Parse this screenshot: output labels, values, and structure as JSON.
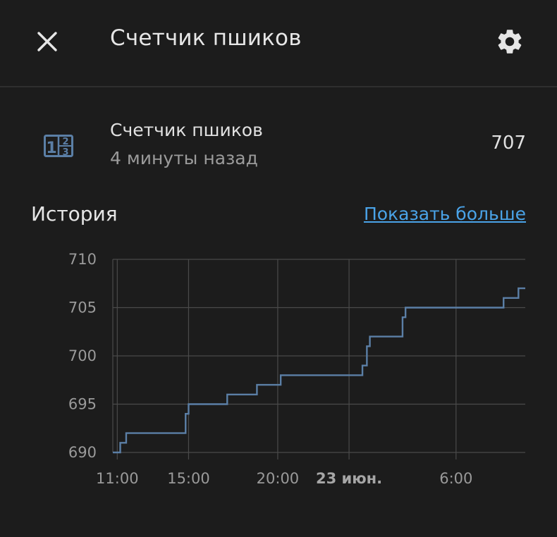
{
  "header": {
    "title": "Счетчик пшиков",
    "close_icon": "close-icon",
    "settings_icon": "gear-icon"
  },
  "entity": {
    "name": "Счетчик пшиков",
    "last_changed": "4 минуты назад",
    "state": "707",
    "icon": "counter-icon"
  },
  "history": {
    "title": "История",
    "show_more_label": "Показать больше"
  },
  "colors": {
    "background": "#1c1c1c",
    "line": "#5b7fa6",
    "link": "#4aa3e8",
    "grid": "#4a4a4a"
  },
  "chart_data": {
    "type": "line",
    "step": true,
    "x_tick_labels": [
      "11:00",
      "15:00",
      "20:00",
      "23 июн.",
      "6:00"
    ],
    "y_tick_labels": [
      "710",
      "705",
      "700",
      "695",
      "690"
    ],
    "ylim": [
      690,
      710
    ],
    "xlim": [
      "10:45",
      "09:53"
    ],
    "grid": true,
    "series": [
      {
        "x": [
          "10:45",
          "11:10",
          "11:30",
          "14:50",
          "15:00",
          "17:10",
          "18:50",
          "20:10",
          "00:45",
          "01:00",
          "01:10",
          "03:00",
          "03:10",
          "08:40",
          "09:30"
        ],
        "values": [
          690,
          691,
          692,
          694,
          695,
          696,
          697,
          698,
          699,
          701,
          702,
          704,
          705,
          706,
          707
        ]
      }
    ]
  }
}
